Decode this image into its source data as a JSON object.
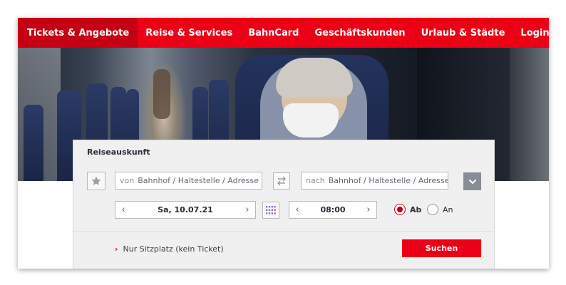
{
  "nav": {
    "items": [
      {
        "label": "Tickets & Angebote",
        "active": true
      },
      {
        "label": "Reise & Services"
      },
      {
        "label": "BahnCard"
      },
      {
        "label": "Geschäftskunden"
      },
      {
        "label": "Urlaub & Städte"
      }
    ],
    "login_label": "Login"
  },
  "search": {
    "title": "Reiseauskunft",
    "from_prefix": "von",
    "from_placeholder": "Bahnhof / Haltestelle / Adresse",
    "to_prefix": "nach",
    "to_placeholder": "Bahnhof / Haltestelle / Adresse",
    "date_value": "Sa, 10.07.21",
    "time_value": "08:00",
    "departure_label": "Ab",
    "arrival_label": "An",
    "selected_mode": "Ab",
    "seat_only_link": "Nur Sitzplatz (kein Ticket)",
    "submit_label": "Suchen"
  },
  "colors": {
    "brand_red": "#ec0016",
    "nav_active": "#c50014",
    "panel_bg": "#f0f0f0"
  },
  "icons": [
    "star-icon",
    "swap-icon",
    "chevron-down-icon",
    "chevron-left-icon",
    "chevron-right-icon",
    "calendar-icon"
  ]
}
